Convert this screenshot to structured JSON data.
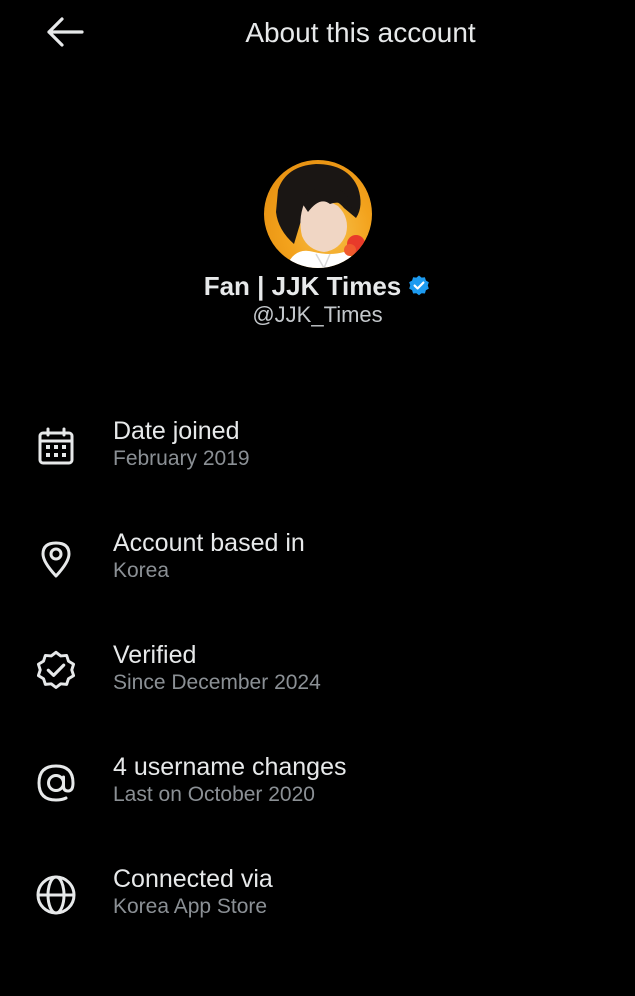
{
  "header": {
    "title": "About this account",
    "back_icon": "arrow-left-icon"
  },
  "profile": {
    "display_name": "Fan | JJK Times",
    "handle": "@JJK_Times",
    "verified_color": "#1d9bf0",
    "avatar_bg": "#f3a21c"
  },
  "items": [
    {
      "icon": "calendar-icon",
      "title": "Date joined",
      "subtitle": "February 2019"
    },
    {
      "icon": "location-pin-icon",
      "title": "Account based in",
      "subtitle": "Korea"
    },
    {
      "icon": "verified-badge-icon",
      "title": "Verified",
      "subtitle": "Since December 2024"
    },
    {
      "icon": "at-sign-icon",
      "title": "4 username changes",
      "subtitle": "Last on October 2020"
    },
    {
      "icon": "globe-icon",
      "title": "Connected via",
      "subtitle": "Korea App Store"
    }
  ],
  "colors": {
    "background": "#000000",
    "primary_text": "#e7e9ea",
    "secondary_text": "#8b9095"
  }
}
